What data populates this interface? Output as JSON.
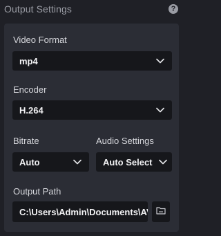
{
  "header": {
    "title": "Output Settings",
    "help_icon": "question-circle-icon",
    "help_glyph": "?"
  },
  "video_format": {
    "label": "Video Format",
    "value": "mp4"
  },
  "encoder": {
    "label": "Encoder",
    "value": "H.264"
  },
  "bitrate": {
    "label": "Bitrate",
    "value": "Auto"
  },
  "audio_settings": {
    "label": "Audio Settings",
    "value": "Auto Select"
  },
  "output_path": {
    "label": "Output Path",
    "value": "C:\\Users\\Admin\\Documents\\AVC",
    "browse_icon": "folder-icon"
  },
  "colors": {
    "background": "#1f2026",
    "card": "#2b2d35",
    "field": "#16171b",
    "text": "#d6d7dc",
    "muted": "#9a9ca4"
  }
}
